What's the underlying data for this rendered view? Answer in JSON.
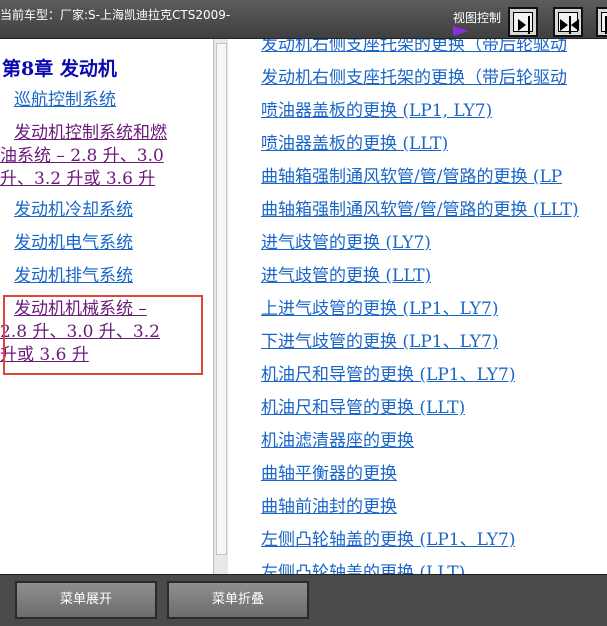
{
  "header": {
    "car_model_text": "当前车型：厂家:S-上海凯迪拉克CTS2009-",
    "view_control_label": "视图控制",
    "view_buttons": [
      "collapse-left-pane-icon",
      "split-pane-icon",
      "expand-right-pane-icon"
    ]
  },
  "left_nav": {
    "chapter_title": "第8章  发动机",
    "stray_char": "〔",
    "items": [
      {
        "lines": [
          "巡航控制系统"
        ],
        "state": "unvisited"
      },
      {
        "lines": [
          "发动机控制系统和燃",
          "油系统 – 2.8 升、3.0",
          "升、3.2 升或 3.6 升"
        ],
        "state": "visited"
      },
      {
        "lines": [
          "发动机冷却系统"
        ],
        "state": "unvisited"
      },
      {
        "lines": [
          "发动机电气系统"
        ],
        "state": "unvisited"
      },
      {
        "lines": [
          "发动机排气系统"
        ],
        "state": "unvisited"
      },
      {
        "lines": [
          "发动机机械系统 –",
          "2.8 升、3.0 升、3.2",
          "升或 3.6 升"
        ],
        "state": "visited",
        "highlighted": true
      }
    ]
  },
  "right_list": {
    "items": [
      "发动机右侧支座托架的更换（带后轮驱动",
      "发动机右侧支座托架的更换（带后轮驱动",
      "喷油器盖板的更换 (LP1, LY7)",
      "喷油器盖板的更换 (LLT)",
      "曲轴箱强制通风软管/管/管路的更换 (LP",
      "曲轴箱强制通风软管/管/管路的更换 (LLT)",
      "进气歧管的更换 (LY7)",
      "进气歧管的更换 (LLT)",
      "上进气歧管的更换 (LP1、LY7)",
      "下进气歧管的更换 (LP1、LY7)",
      "机油尺和导管的更换 (LP1、LY7)",
      "机油尺和导管的更换 (LLT)",
      "机油滤清器座的更换",
      "曲轴平衡器的更换",
      "曲轴前油封的更换",
      "左侧凸轮轴盖的更换 (LP1、LY7)",
      "左侧凸轮轴盖的更换 (LLT)"
    ]
  },
  "footer": {
    "expand_label": "菜单展开",
    "collapse_label": "菜单折叠"
  },
  "colors": {
    "link_blue": "#1a66c8",
    "visited_purple": "#6b1a7a",
    "highlight_red": "#e0453a",
    "view_arrow_purple": "#8a2be2"
  }
}
